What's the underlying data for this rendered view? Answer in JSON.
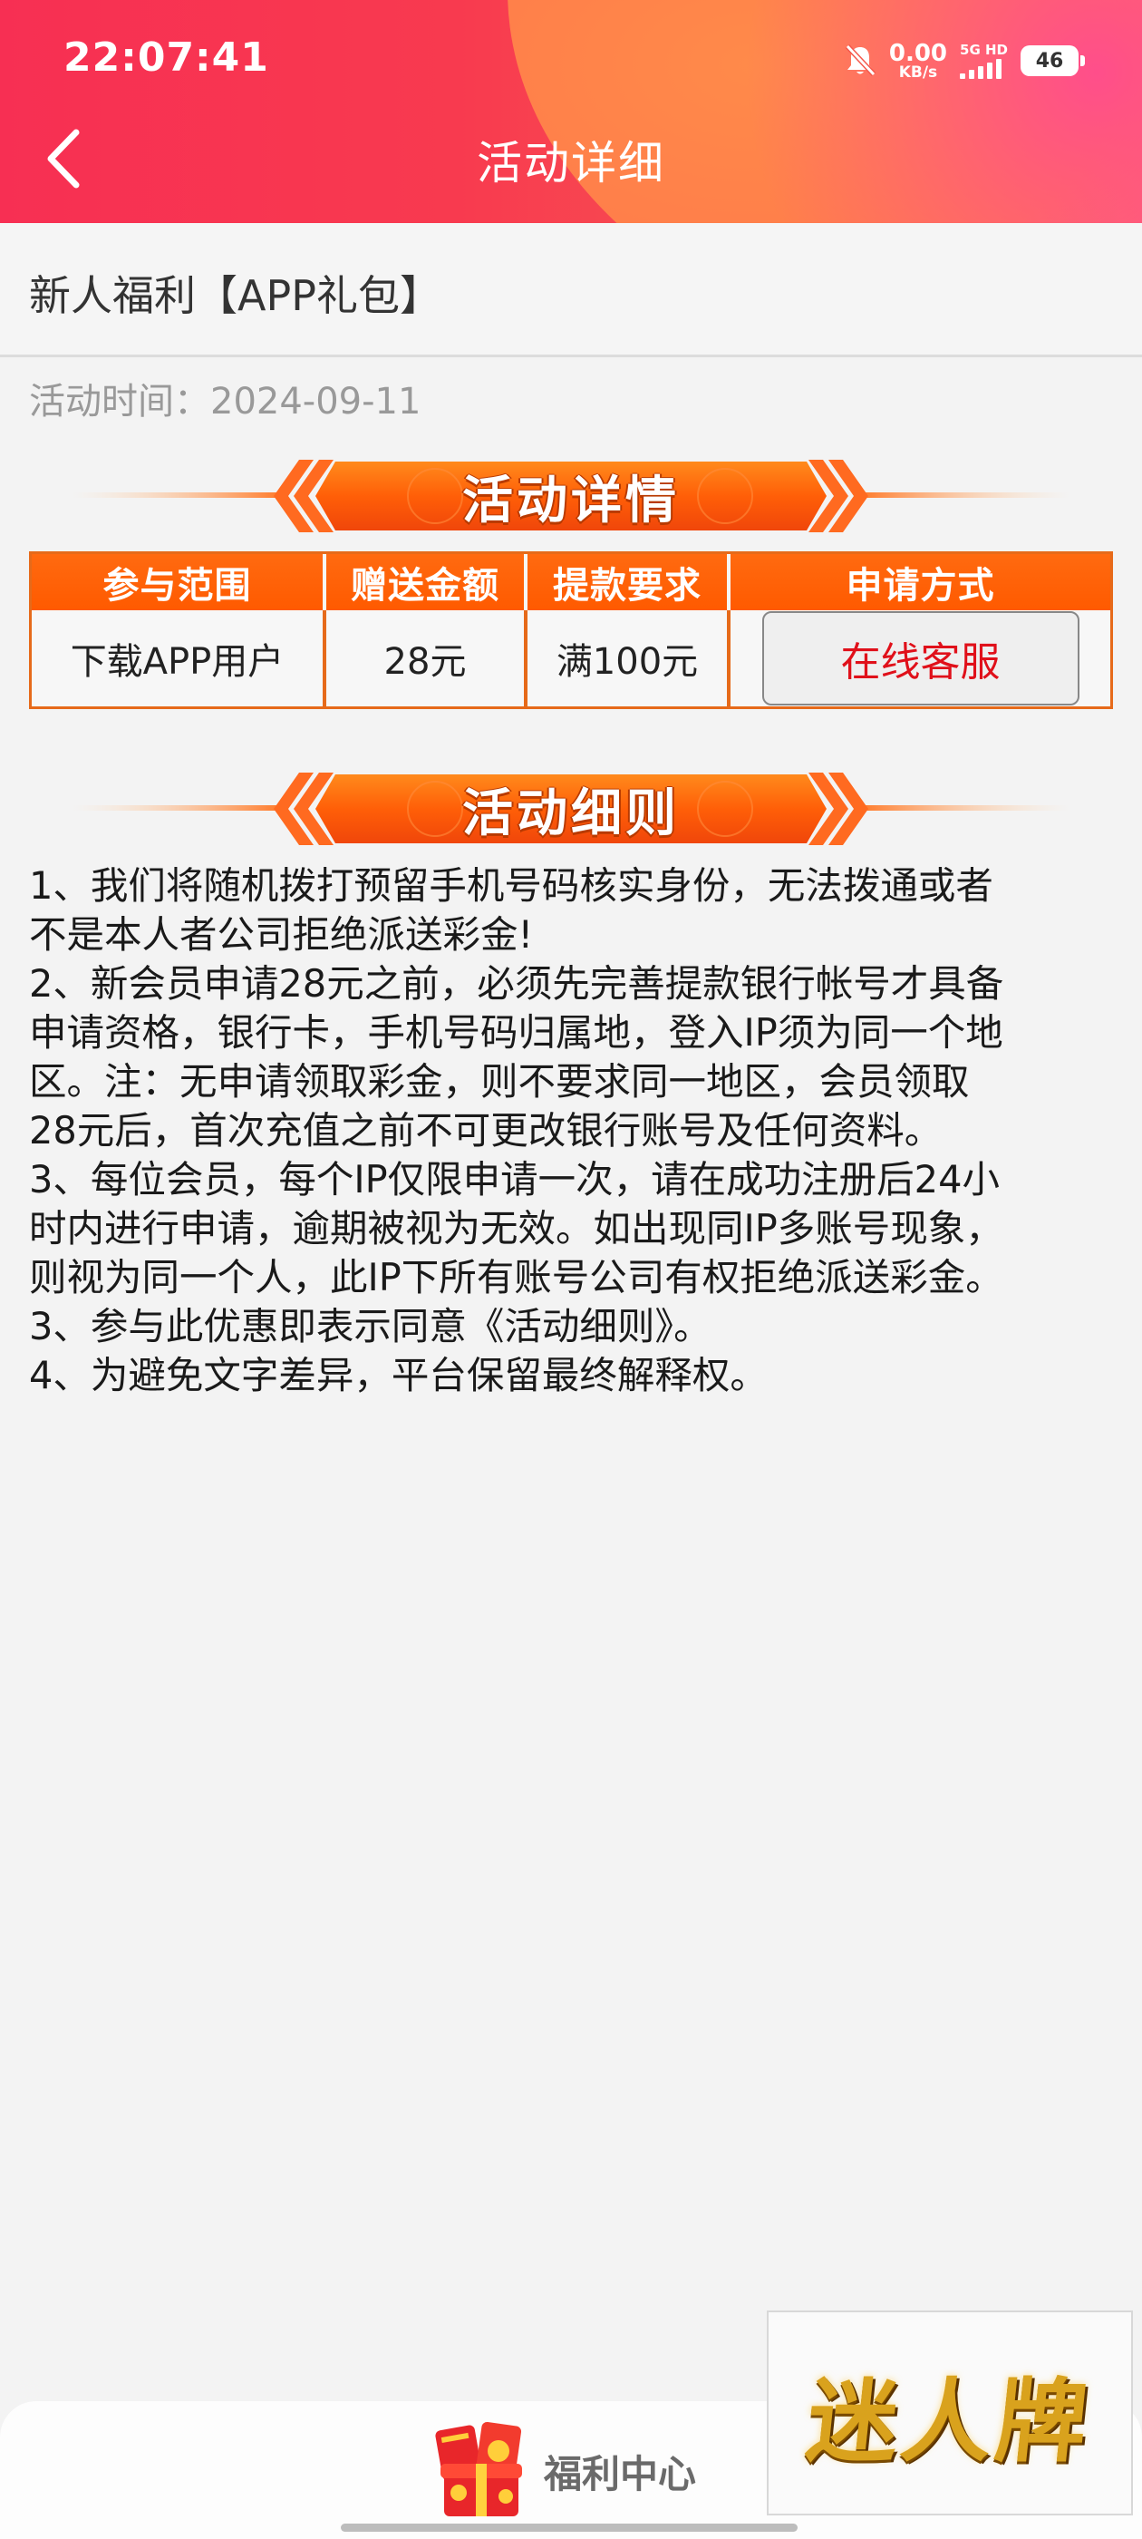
{
  "status_bar": {
    "time": "22:07:41",
    "net_speed_value": "0.00",
    "net_speed_unit": "KB/s",
    "network_label": "5G HD",
    "battery": "46"
  },
  "header": {
    "title": "活动详细"
  },
  "promo": {
    "title": "新人福利【APP礼包】",
    "time": "活动时间：2024-09-11"
  },
  "banners": {
    "details": "活动详情",
    "rules": "活动细则"
  },
  "table": {
    "headers": [
      "参与范围",
      "赠送金额",
      "提款要求",
      "申请方式"
    ],
    "row": {
      "scope": "下载APP用户",
      "amount": "28元",
      "requirement": "满100元",
      "apply_button": "在线客服"
    }
  },
  "rules": [
    "1、我们将随机拨打预留手机号码核实身份，无法拨通或者",
    "不是本人者公司拒绝派送彩金!",
    "2、新会员申请28元之前，必须先完善提款银行帐号才具备",
    "申请资格，银行卡，手机号码归属地，登入IP须为同一个地",
    "区。注：无申请领取彩金，则不要求同一地区，会员领取",
    "28元后，首次充值之前不可更改银行账号及任何资料。",
    "3、每位会员，每个IP仅限申请一次，请在成功注册后24小",
    "时内进行申请，逾期被视为无效。如出现同IP多账号现象，",
    "则视为同一个人，此IP下所有账号公司有权拒绝派送彩金。",
    "3、参与此优惠即表示同意《活动细则》。",
    "4、为避免文字差异，平台保留最终解释权。"
  ],
  "bottom": {
    "welfare_label": "福利中心",
    "logo_text": "迷人牌"
  },
  "colors": {
    "header_red": "#f72f53",
    "accent_orange": "#ff5a00",
    "apply_text_red": "#e0101a"
  }
}
